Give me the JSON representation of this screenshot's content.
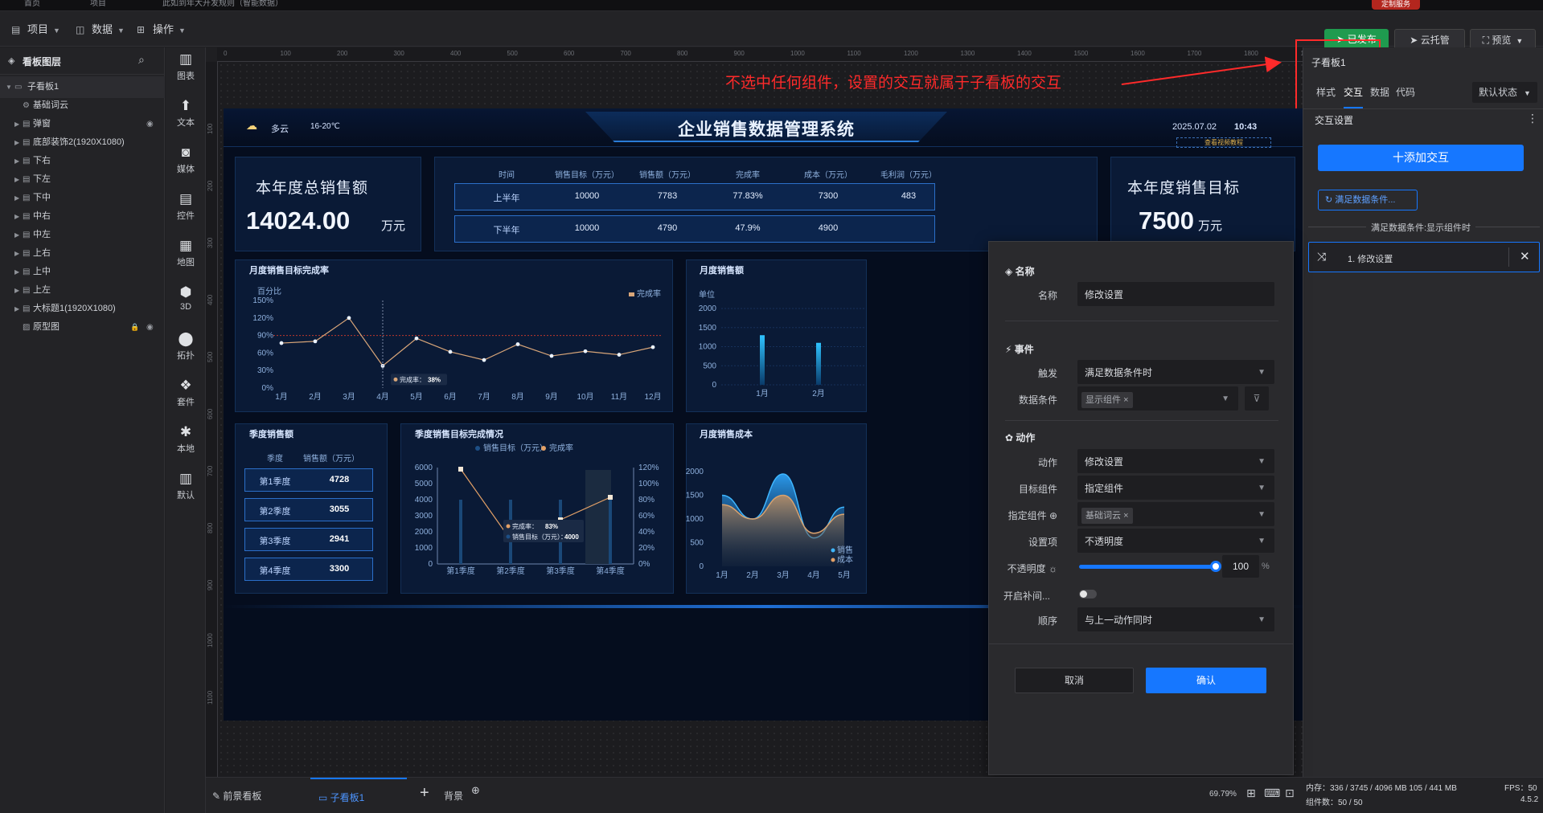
{
  "tabs": [
    "首页",
    "项目",
    "此如到年大开发规则（智能数据）"
  ],
  "top_badge": "定制服务",
  "menu": {
    "project": "项目",
    "data": "数据",
    "operation": "操作"
  },
  "toolbar": {
    "publish": "已发布",
    "cloud": "云托管",
    "preview": "预览"
  },
  "layers": {
    "title": "看板图层",
    "items": [
      {
        "label": "子看板1",
        "level": 0,
        "expanded": true
      },
      {
        "label": "基础词云",
        "level": 1
      },
      {
        "label": "弹窗",
        "level": 1
      },
      {
        "label": "底部装饰2(1920X1080)",
        "level": 1
      },
      {
        "label": "下右",
        "level": 1
      },
      {
        "label": "下左",
        "level": 1
      },
      {
        "label": "下中",
        "level": 1
      },
      {
        "label": "中右",
        "level": 1
      },
      {
        "label": "中左",
        "level": 1
      },
      {
        "label": "上右",
        "level": 1
      },
      {
        "label": "上中",
        "level": 1
      },
      {
        "label": "上左",
        "level": 1
      },
      {
        "label": "大标题1(1920X1080)",
        "level": 1
      },
      {
        "label": "原型图",
        "level": 1
      }
    ]
  },
  "tools": [
    "图表",
    "文本",
    "媒体",
    "控件",
    "地图",
    "3D",
    "拓扑",
    "套件",
    "本地",
    "默认"
  ],
  "ruler": {
    "top": [
      "0",
      "100",
      "200",
      "300",
      "400",
      "500",
      "600",
      "700",
      "800",
      "900",
      "1000",
      "1100",
      "1200",
      "1300",
      "1400",
      "1500",
      "1600",
      "1700",
      "1800",
      "1900"
    ],
    "left": [
      "100",
      "200",
      "300",
      "400",
      "500",
      "600",
      "700",
      "800",
      "900",
      "1000",
      "1100"
    ]
  },
  "annotation": "不选中任何组件，设置的交互就属于子看板的交互",
  "dashboard": {
    "weather": "多云",
    "temp": "16-20℃",
    "title": "企业销售数据管理系统",
    "date": "2025.07.02",
    "time": "10:43",
    "link": "查看视频教程",
    "total_label": "本年度总销售额",
    "total_value": "14024.00",
    "total_unit": "万元",
    "target_label": "本年度销售目标",
    "target_value": "7500",
    "target_unit": "万元",
    "table": {
      "headers": [
        "时间",
        "销售目标（万元）",
        "销售额（万元）",
        "完成率",
        "成本（万元）",
        "毛利润（万元）"
      ],
      "rows": [
        [
          "上半年",
          "10000",
          "7783",
          "77.83%",
          "7300",
          "483"
        ],
        [
          "下半年",
          "10000",
          "4790",
          "47.9%",
          "4900",
          ""
        ]
      ]
    },
    "panel_titles": {
      "monthly_rate": "月度销售目标完成率",
      "monthly_sales": "月度销售额",
      "quarter_sales": "季度销售额",
      "quarter_rate": "季度销售目标完成情况",
      "monthly_cost": "月度销售成本"
    },
    "line_panel": {
      "ylabel": "百分比",
      "legend": "完成率",
      "tooltip": "完成率：",
      "tooltip_value": "38%"
    },
    "bar_panel": {
      "ylabel": "单位"
    },
    "quarter_table": {
      "headers": [
        "季度",
        "销售额（万元）"
      ],
      "rows": [
        [
          "第1季度",
          "4728"
        ],
        [
          "第2季度",
          "3055"
        ],
        [
          "第3季度",
          "2941"
        ],
        [
          "第4季度",
          "3300"
        ]
      ]
    },
    "combo_panel": {
      "legend_bar": "销售目标（万元）",
      "legend_line": "完成率",
      "tip_rate": "完成率：",
      "tip_rate_value": "83%",
      "tip_target": "销售目标（万元）：",
      "tip_target_value": "4000"
    },
    "area_panel": {
      "legend_a": "销售",
      "legend_b": "成本"
    }
  },
  "chart_data": [
    {
      "type": "line",
      "title": "月度销售目标完成率",
      "categories": [
        "1月",
        "2月",
        "3月",
        "4月",
        "5月",
        "6月",
        "7月",
        "8月",
        "9月",
        "10月",
        "11月",
        "12月"
      ],
      "series": [
        {
          "name": "完成率",
          "values": [
            77,
            80,
            120,
            38,
            85,
            62,
            48,
            75,
            55,
            63,
            57,
            70
          ]
        }
      ],
      "yticks": [
        "0%",
        "30%",
        "60%",
        "90%",
        "120%",
        "150%"
      ],
      "ylim": [
        0,
        150
      ],
      "ylabel": "百分比"
    },
    {
      "type": "bar",
      "title": "月度销售额",
      "categories": [
        "1月",
        "2月"
      ],
      "values": [
        1300,
        1100
      ],
      "yticks": [
        "0",
        "500",
        "1000",
        "1500",
        "2000"
      ],
      "ylim": [
        0,
        2000
      ],
      "ylabel": "单位"
    },
    {
      "type": "bar",
      "title": "季度销售目标完成情况",
      "categories": [
        "第1季度",
        "第2季度",
        "第3季度",
        "第4季度"
      ],
      "series": [
        {
          "name": "销售目标（万元）",
          "values": [
            4000,
            4000,
            4000,
            4000
          ]
        },
        {
          "name": "完成率",
          "values": [
            118,
            30,
            55,
            83
          ]
        }
      ],
      "yticks_left": [
        "0",
        "1000",
        "2000",
        "3000",
        "4000",
        "5000",
        "6000"
      ],
      "yticks_right": [
        "0%",
        "20%",
        "40%",
        "60%",
        "80%",
        "100%",
        "120%"
      ],
      "ylim": [
        0,
        6000
      ]
    },
    {
      "type": "area",
      "title": "月度销售成本",
      "categories": [
        "1月",
        "2月",
        "3月",
        "4月",
        "5月"
      ],
      "series": [
        {
          "name": "销售",
          "values": [
            1500,
            1000,
            1950,
            600,
            1250
          ]
        },
        {
          "name": "成本",
          "values": [
            1300,
            1000,
            1500,
            700,
            1100
          ]
        }
      ],
      "yticks": [
        "0",
        "500",
        "1000",
        "1500",
        "2000"
      ],
      "ylim": [
        0,
        2000
      ]
    }
  ],
  "props": {
    "title": "子看板1",
    "tabs": [
      "样式",
      "交互",
      "数据",
      "代码"
    ],
    "state": "默认状态",
    "section": "交互设置",
    "add_button": "十添加交互",
    "condition_button": "满足数据条件...",
    "condition_caption": "满足数据条件:显示组件时",
    "item": "1. 修改设置"
  },
  "dialog": {
    "name_section": "名称",
    "name_label": "名称",
    "name_value": "修改设置",
    "event_section": "事件",
    "trigger_label": "触发",
    "trigger_value": "满足数据条件时",
    "datacond_label": "数据条件",
    "datacond_tag": "显示组件",
    "action_section": "动作",
    "action_label": "动作",
    "action_value": "修改设置",
    "target_label": "目标组件",
    "target_value": "指定组件",
    "specified_label": "指定组件",
    "specified_tag": "基础词云",
    "setting_label": "设置项",
    "setting_value": "不透明度",
    "opacity_label": "不透明度",
    "opacity_value": "100",
    "opacity_unit": "%",
    "opacity_level": 1.0,
    "tween_label": "开启补间...",
    "order_label": "顺序",
    "order_value": "与上一动作同时",
    "cancel": "取消",
    "confirm": "确认"
  },
  "bottom": {
    "tab_front": "前景看板",
    "tab_sub": "子看板1",
    "tab_bg": "背景",
    "zoom": "69.79%",
    "memory": "内存：336 / 3745 / 4096 MB 105 / 441 MB",
    "fps": "FPS：50",
    "components": "组件数：50 / 50",
    "version": "4.5.2"
  },
  "colors": {
    "accent": "#1677ff",
    "publish": "#1f9b4f",
    "annotation": "#ff2a2a",
    "dash_bg": "#050d1e",
    "chart_cyan": "#2fc3ff",
    "chart_orange": "#e2a067"
  }
}
